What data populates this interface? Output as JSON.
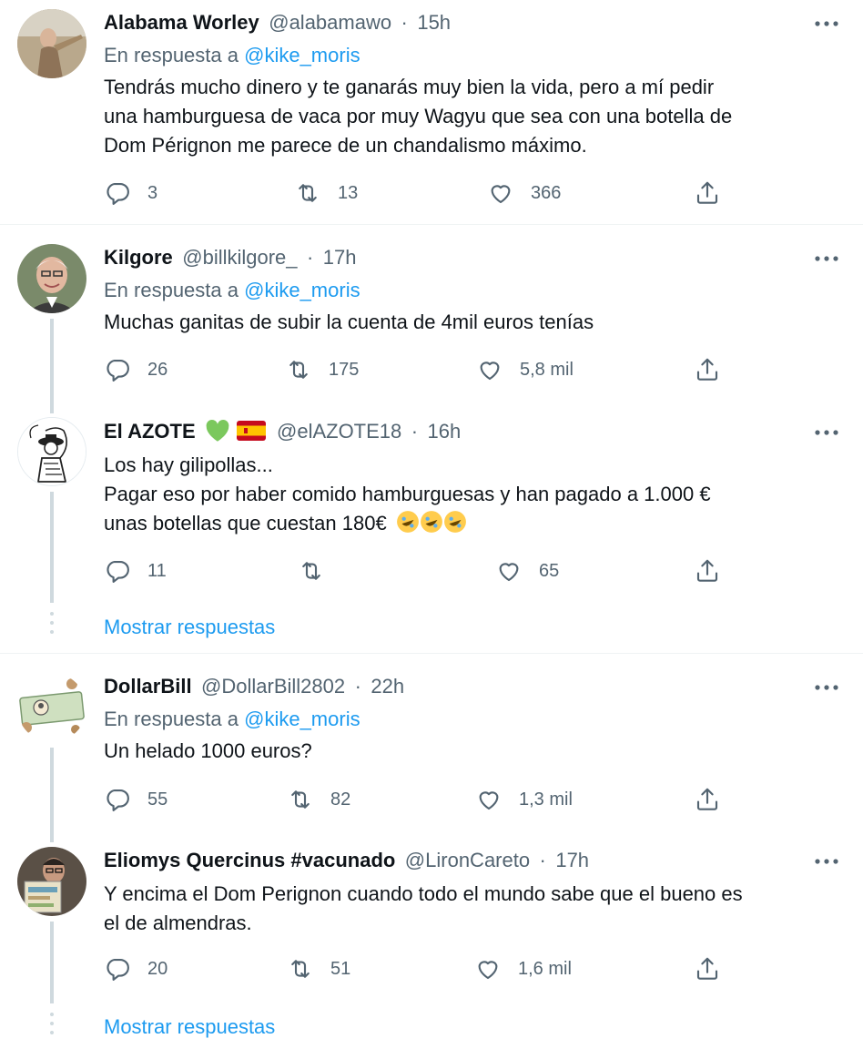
{
  "reply_prefix": "En respuesta a",
  "show_replies": "Mostrar respuestas",
  "tweets": [
    {
      "name": "Alabama Worley",
      "handle": "@alabamawo",
      "time": "15h",
      "reply_to": "@kike_moris",
      "text": [
        "Tendrás mucho dinero y te ganarás muy bien la vida, pero a mí pedir",
        "una hamburguesa de vaca por muy Wagyu que sea con una botella de",
        "Dom Pérignon me parece de un chandalismo máximo."
      ],
      "replies": "3",
      "retweets": "13",
      "likes": "366"
    },
    {
      "name": "Kilgore",
      "handle": "@billkilgore_",
      "time": "17h",
      "reply_to": "@kike_moris",
      "text": [
        "Muchas ganitas de subir la cuenta de 4mil euros tenías"
      ],
      "replies": "26",
      "retweets": "175",
      "likes": "5,8 mil"
    },
    {
      "name": "El AZOTE",
      "name_emojis": "green-heart, spain-flag",
      "handle": "@elAZOTE18",
      "time": "16h",
      "text": [
        "Los hay gilipollas...",
        "Pagar eso por haber comido hamburguesas y han pagado a 1.000 €",
        "unas botellas que cuestan 180€"
      ],
      "text_emojis": "rolling-on-floor-laughing x3",
      "replies": "11",
      "retweets": "",
      "likes": "65"
    },
    {
      "name": "DollarBill",
      "handle": "@DollarBill2802",
      "time": "22h",
      "reply_to": "@kike_moris",
      "text": [
        "Un helado 1000 euros?"
      ],
      "replies": "55",
      "retweets": "82",
      "likes": "1,3 mil"
    },
    {
      "name": "Eliomys Quercinus #vacunado",
      "handle": "@LironCareto",
      "time": "17h",
      "text": [
        "Y encima el Dom Perignon cuando todo el mundo sabe que el bueno es",
        "el de almendras."
      ],
      "replies": "20",
      "retweets": "51",
      "likes": "1,6 mil"
    }
  ],
  "colors": {
    "text": "#0f1419",
    "secondary": "#536471",
    "link": "#1d9bf0",
    "line": "#cfd9de"
  }
}
